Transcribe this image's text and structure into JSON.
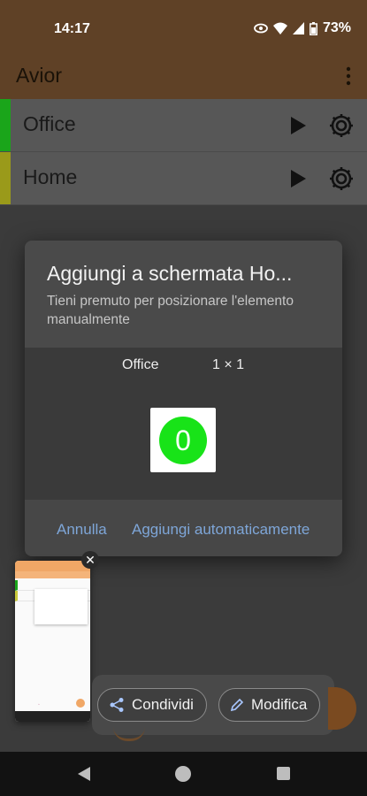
{
  "status_bar": {
    "time": "14:17",
    "battery": "73%"
  },
  "app": {
    "title": "Avior",
    "rows": [
      {
        "label": "Office",
        "color": "#1aa51a"
      },
      {
        "label": "Home",
        "color": "#9a9a1a"
      }
    ]
  },
  "dialog": {
    "title": "Aggiungi a schermata Ho...",
    "subtitle": "Tieni premuto per posizionare l'elemento manualmente",
    "widget_name": "Office",
    "widget_size": "1 × 1",
    "widget_value": "0",
    "cancel_label": "Annulla",
    "auto_add_label": "Aggiungi automaticamente"
  },
  "screenshot_actions": {
    "share_label": "Condividi",
    "edit_label": "Modifica"
  },
  "colors": {
    "accent_link": "#7ea6d8",
    "widget_green": "#18e318",
    "app_bar": "#5f4126"
  }
}
